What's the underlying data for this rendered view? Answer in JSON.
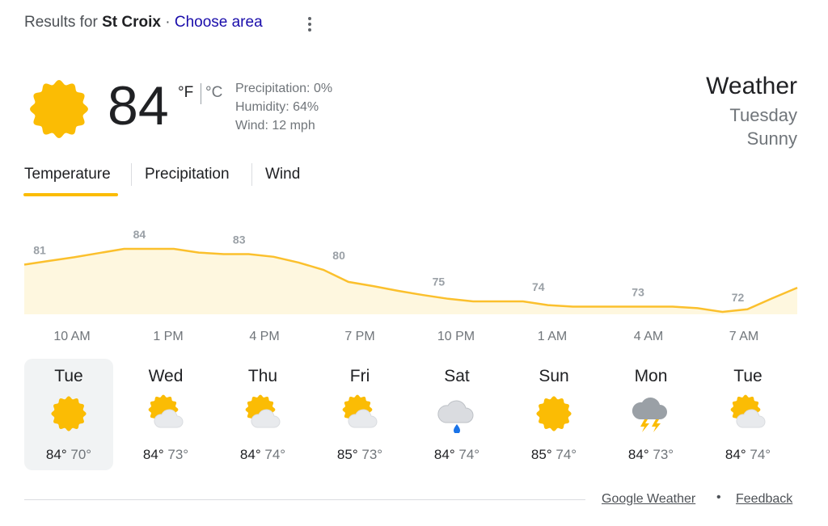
{
  "header": {
    "results_prefix": "Results for",
    "location": "St Croix",
    "separator": "·",
    "choose_area": "Choose area",
    "menu_icon": "more-vert-icon"
  },
  "current": {
    "icon": "sunny-icon",
    "temperature": "84",
    "unit_f": "°F",
    "unit_c": "°C",
    "precipitation": "Precipitation: 0%",
    "humidity": "Humidity: 64%",
    "wind": "Wind: 12 mph"
  },
  "summary": {
    "title": "Weather",
    "day": "Tuesday",
    "condition": "Sunny"
  },
  "tabs": [
    {
      "label": "Temperature",
      "selected": true
    },
    {
      "label": "Precipitation",
      "selected": false
    },
    {
      "label": "Wind",
      "selected": false
    }
  ],
  "chart_data": {
    "type": "area",
    "title": "",
    "xlabel": "",
    "ylabel": "",
    "categories": [
      "10 AM",
      "1 PM",
      "4 PM",
      "7 PM",
      "10 PM",
      "1 AM",
      "4 AM",
      "7 AM"
    ],
    "values": [
      81,
      84,
      83,
      80,
      75,
      74,
      73,
      72
    ],
    "point_labels": [
      "81",
      "84",
      "83",
      "80",
      "75",
      "74",
      "73",
      "72"
    ],
    "hourly_values": [
      81,
      81.7,
      82.4,
      83.2,
      84,
      84,
      84,
      83.3,
      83,
      83,
      82.5,
      81.4,
      80,
      77.7,
      76.9,
      76,
      75.2,
      74.5,
      74,
      74,
      74,
      73.3,
      73,
      73,
      73,
      73,
      73,
      72.7,
      72,
      72.5,
      74.6,
      76.6
    ],
    "grid": false,
    "legend": "none",
    "line_color": "#fbc02d",
    "fill_color": "#fef7df"
  },
  "forecast": [
    {
      "day": "Tue",
      "icon": "sunny-icon",
      "hi": "84°",
      "lo": "70°",
      "selected": true
    },
    {
      "day": "Wed",
      "icon": "partly-cloudy-icon",
      "hi": "84°",
      "lo": "73°",
      "selected": false
    },
    {
      "day": "Thu",
      "icon": "partly-cloudy-icon",
      "hi": "84°",
      "lo": "74°",
      "selected": false
    },
    {
      "day": "Fri",
      "icon": "partly-cloudy-icon",
      "hi": "85°",
      "lo": "73°",
      "selected": false
    },
    {
      "day": "Sat",
      "icon": "rain-icon",
      "hi": "84°",
      "lo": "74°",
      "selected": false
    },
    {
      "day": "Sun",
      "icon": "sunny-icon",
      "hi": "85°",
      "lo": "74°",
      "selected": false
    },
    {
      "day": "Mon",
      "icon": "thunderstorm-icon",
      "hi": "84°",
      "lo": "73°",
      "selected": false
    },
    {
      "day": "Tue",
      "icon": "partly-cloudy-icon",
      "hi": "84°",
      "lo": "74°",
      "selected": false
    }
  ],
  "footer": {
    "source_link": "Google Weather",
    "dot": "•",
    "feedback_link": "Feedback"
  },
  "colors": {
    "sun": "#fbbc04",
    "sun_edge": "#f29900",
    "accent_underline": "#fbbc04",
    "link_blue": "#1a0dab",
    "cloud": "#e8eaed",
    "storm_cloud": "#9aa0a6",
    "rain_drop": "#1a73e8"
  }
}
